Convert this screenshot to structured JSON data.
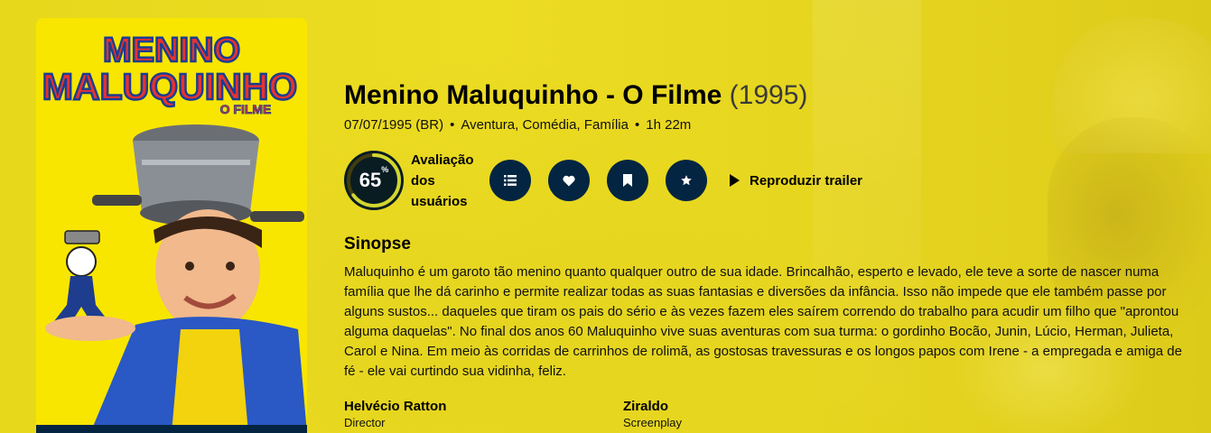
{
  "movie": {
    "title": "Menino Maluquinho - O Filme",
    "year": "(1995)",
    "release": "07/07/1995 (BR)",
    "genres": "Aventura, Comédia, Família",
    "runtime": "1h 22m",
    "score": "65",
    "score_pct": 65,
    "score_unit": "%",
    "score_label": "Avaliação dos usuários",
    "trailer_label": "Reproduzir trailer",
    "overview_heading": "Sinopse",
    "overview": "Maluquinho é um garoto tão menino quanto qualquer outro de sua idade. Brincalhão, esperto e levado, ele teve a sorte de nascer numa família que lhe dá carinho e permite realizar todas as suas fantasias e diversões da infância. Isso não impede que ele também passe por alguns sustos... daqueles que tiram os pais do sério e às vezes fazem eles saírem correndo do trabalho para acudir um filho que \"aprontou alguma daquelas\". No final dos anos 60 Maluquinho vive suas aventuras com sua turma: o gordinho Bocão, Junin, Lúcio, Herman, Julieta, Carol e Nina. Em meio às corridas de carrinhos de rolimã, as gostosas travessuras e os longos papos com Irene - a empregada e amiga de fé - ele vai curtindo sua vidinha, feliz.",
    "crew": [
      {
        "name": "Helvécio Ratton",
        "job": "Director"
      },
      {
        "name": "Ziraldo",
        "job": "Screenplay"
      }
    ]
  },
  "poster": {
    "line1": "MENINO",
    "line2": "MALUQUINHO",
    "line3": "O FILME"
  },
  "actions": [
    {
      "icon": "list-icon"
    },
    {
      "icon": "heart-icon"
    },
    {
      "icon": "bookmark-icon"
    },
    {
      "icon": "star-icon"
    }
  ],
  "colors": {
    "background": "#ecdc1f",
    "button": "#032541",
    "score_ring": "#d2d531",
    "score_track": "#423d0f"
  }
}
